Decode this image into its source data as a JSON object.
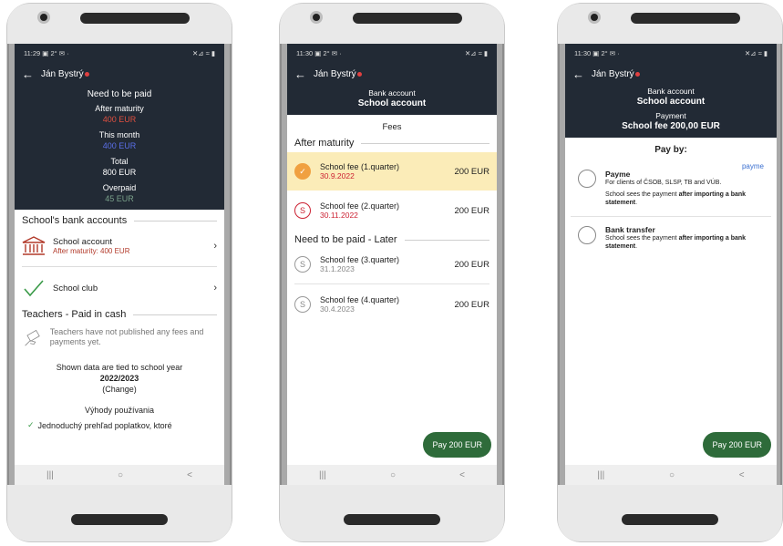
{
  "screen1": {
    "time": "11:29 ▣ 2° ✉ ·",
    "signal": "✕⊿ ≈ ▮",
    "user": "Ján Bystrý",
    "need_title": "Need to be paid",
    "after_maturity_label": "After maturity",
    "after_maturity_value": "400 EUR",
    "this_month_label": "This month",
    "this_month_value": "400 EUR",
    "total_label": "Total",
    "total_value": "800 EUR",
    "overpaid_label": "Overpaid",
    "overpaid_value": "45 EUR",
    "bank_section": "School's bank accounts",
    "account_name": "School account",
    "account_status": "After maturity: 400 EUR",
    "club_name": "School club",
    "teachers_section": "Teachers - Paid in cash",
    "teachers_text": "Teachers have not published any fees and payments yet.",
    "school_year_text": "Shown data are tied to school year",
    "school_year": "2022/2023",
    "change": "(Change)",
    "benefits_title": "Výhody používania",
    "benefit1": "Jednoduchý prehľad poplatkov, ktoré"
  },
  "screen2": {
    "time": "11:30 ▣ 2° ✉ ·",
    "signal": "✕⊿ ≈ ▮",
    "user": "Ján Bystrý",
    "bank_label": "Bank account",
    "bank_name": "School account",
    "fees_tab": "Fees",
    "after_maturity_section": "After maturity",
    "later_section": "Need to be paid - Later",
    "fees": [
      {
        "badge": "✓",
        "name": "School fee (1.quarter)",
        "date": "30.9.2022",
        "amount": "200 EUR"
      },
      {
        "badge": "S",
        "name": "School fee (2.quarter)",
        "date": "30.11.2022",
        "amount": "200 EUR"
      },
      {
        "badge": "S",
        "name": "School fee (3.quarter)",
        "date": "31.1.2023",
        "amount": "200 EUR"
      },
      {
        "badge": "S",
        "name": "School fee (4.quarter)",
        "date": "30.4.2023",
        "amount": "200 EUR"
      }
    ],
    "pay_button": "Pay 200 EUR"
  },
  "screen3": {
    "time": "11:30 ▣ 2° ✉ ·",
    "signal": "✕⊿ ≈ ▮",
    "user": "Ján Bystrý",
    "bank_label": "Bank account",
    "bank_name": "School account",
    "payment_label": "Payment",
    "payment_name": "School fee 200,00 EUR",
    "pay_by": "Pay by:",
    "payme_title": "Payme",
    "payme_logo": "payme",
    "payme_desc": "For clients of ČSOB, SLSP, TB and VÚB.",
    "payme_note_a": "School sees the payment ",
    "payme_note_b": "after importing a bank statement",
    "transfer_title": "Bank transfer",
    "transfer_note_a": "School sees the payment ",
    "transfer_note_b": "after importing a bank statement",
    "pay_button": "Pay 200 EUR"
  },
  "nav": {
    "recent": "|||",
    "home": "○",
    "back": "<"
  },
  "colors": {
    "dark": "#222a35",
    "red": "#e05040",
    "blue": "#5a6fe8",
    "green": "#2e6b3a",
    "highlight": "#fbecb8"
  }
}
